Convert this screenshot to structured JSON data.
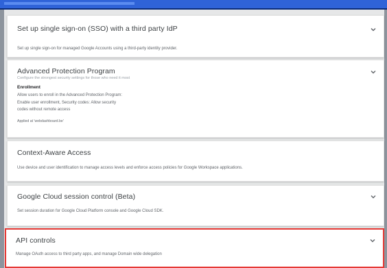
{
  "cards": [
    {
      "title": "Set up single sign-on (SSO) with a third party IdP",
      "description": "Set up single sign-on for managed Google Accounts using a third-party identity provider."
    },
    {
      "title": "Advanced Protection Program",
      "subtitle": "Configure the strongest security settings for those who need it most",
      "section_heading": "Enrollment",
      "lines": [
        "Allow users to enroll in the Advanced Protection Program:",
        "Enable user enrollment, Security codes: Allow security",
        "codes without remote access"
      ],
      "applied": "Applied at 'webdashboard.be'"
    },
    {
      "title": "Context-Aware Access",
      "description": "Use device and user identification to manage access levels and enforce access policies for Google Workspace applications."
    },
    {
      "title": "Google Cloud session control (Beta)",
      "description": "Set session duration for Google Cloud Platform console and Google Cloud SDK."
    },
    {
      "title": "API controls",
      "description": "Manage OAuth access to third party apps, and manage Domain wide delegation"
    }
  ],
  "icons": {
    "expand": "chevron-down-icon"
  },
  "colors": {
    "highlight_border": "#e53935",
    "top_bar": "#2f63d8"
  }
}
